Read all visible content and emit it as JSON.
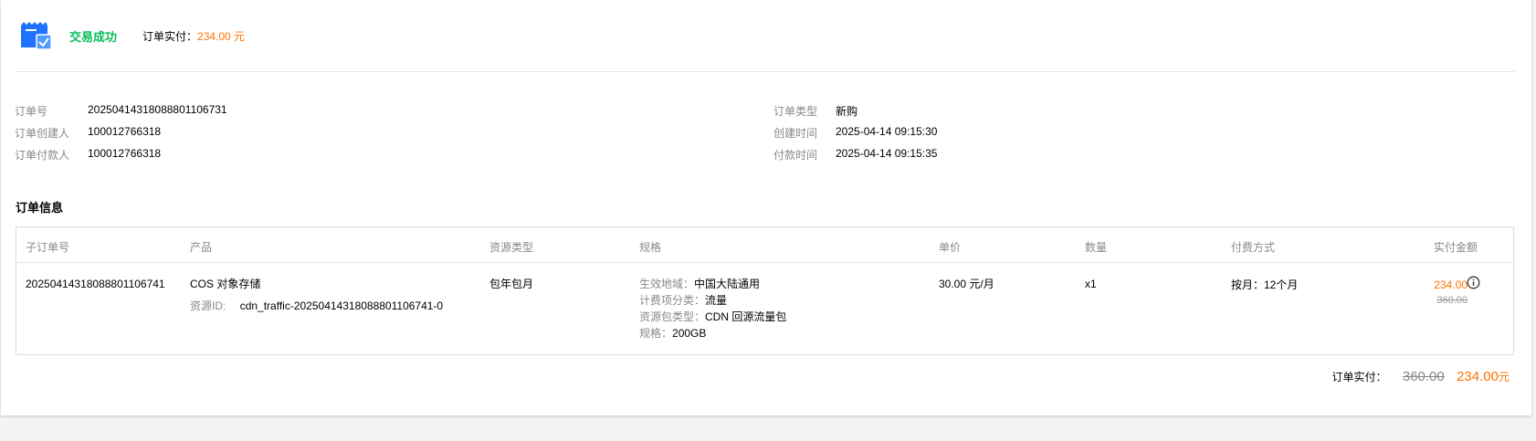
{
  "header": {
    "status": "交易成功",
    "paid_label": "订单实付：",
    "paid_amount": "234.00 元"
  },
  "meta_left": [
    {
      "label": "订单号",
      "value": "20250414318088801106731"
    },
    {
      "label": "订单创建人",
      "value": "100012766318"
    },
    {
      "label": "订单付款人",
      "value": "100012766318"
    }
  ],
  "meta_right": [
    {
      "label": "订单类型",
      "value": "新购"
    },
    {
      "label": "创建时间",
      "value": "2025-04-14 09:15:30"
    },
    {
      "label": "付款时间",
      "value": "2025-04-14 09:15:35"
    }
  ],
  "section_title": "订单信息",
  "table": {
    "headers": [
      "子订单号",
      "产品",
      "资源类型",
      "规格",
      "单价",
      "数量",
      "付费方式",
      "实付金额"
    ],
    "row": {
      "sub_order": "20250414318088801106741",
      "product": "COS 对象存储",
      "resource_id_label": "资源ID:",
      "resource_id": "cdn_traffic-20250414318088801106741-0",
      "resource_type": "包年包月",
      "spec": [
        {
          "label": "生效地域：",
          "value": "中国大陆通用"
        },
        {
          "label": "计费项分类：",
          "value": "流量"
        },
        {
          "label": "资源包类型：",
          "value": "CDN 回源流量包"
        },
        {
          "label": "规格：",
          "value": "200GB"
        }
      ],
      "unit_price": "30.00 元/月",
      "quantity": "x1",
      "billing": "按月：12个月",
      "paid": "234.00",
      "original": "360.00"
    }
  },
  "total": {
    "label": "订单实付：",
    "original": "360.00",
    "paid": "234.00",
    "unit": "元"
  },
  "colors": {
    "success": "#0abf5b",
    "accent": "#ff7200",
    "icon_blue": "#1e72ff"
  },
  "icons": {
    "status": "receipt-check-icon",
    "info": "info-circle-icon"
  }
}
